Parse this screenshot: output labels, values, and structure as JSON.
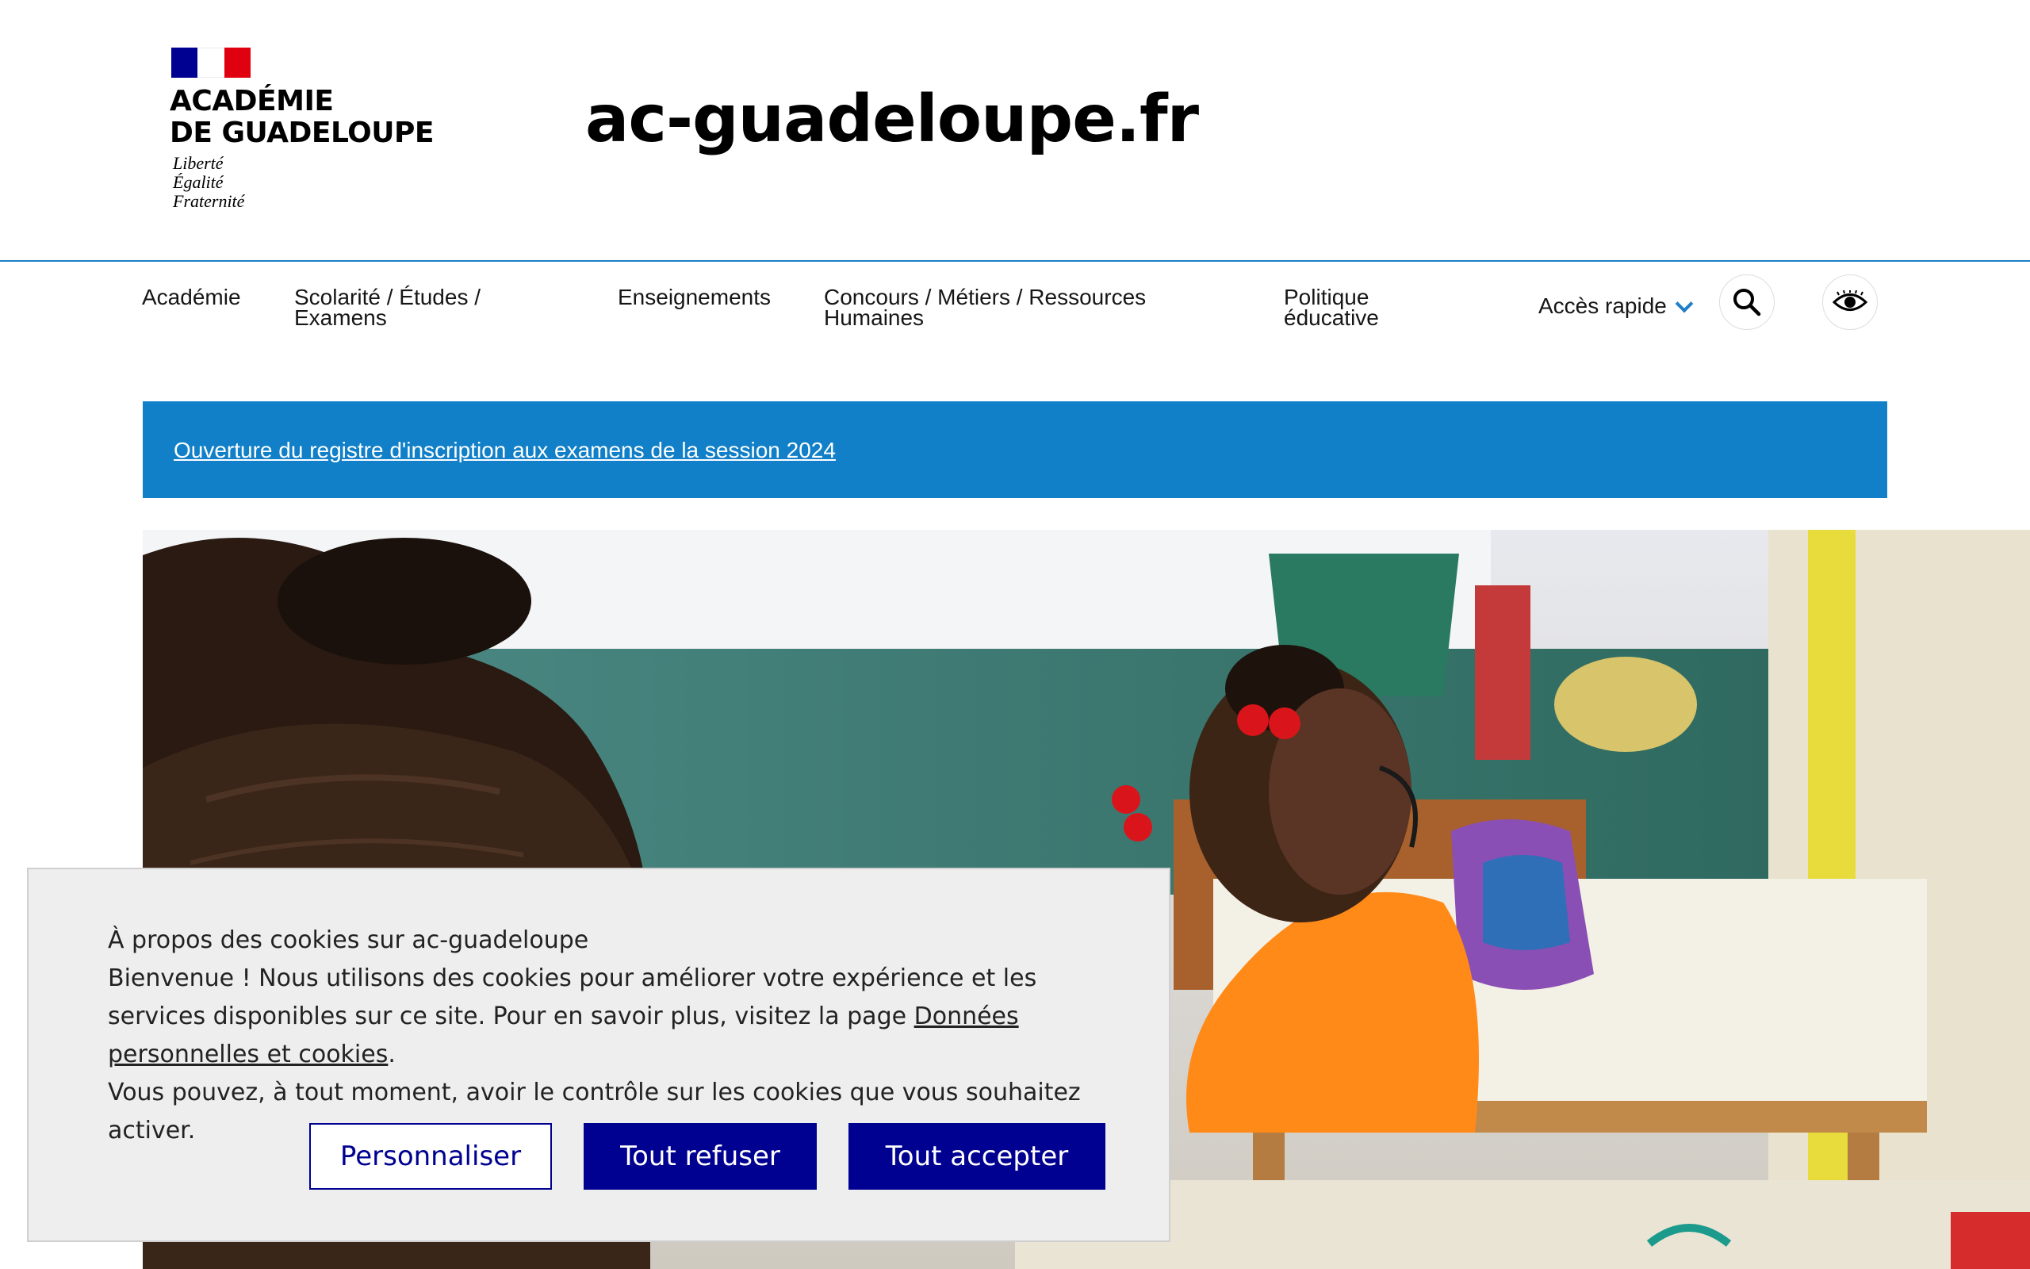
{
  "header": {
    "logo_name_line1": "ACADÉMIE",
    "logo_name_line2": "DE GUADELOUPE",
    "motto_line1": "Liberté",
    "motto_line2": "Égalité",
    "motto_line3": "Fraternité",
    "site_title": "ac-guadeloupe.fr"
  },
  "nav": {
    "items": [
      {
        "label_line1": "Académie",
        "label_line2": ""
      },
      {
        "label_line1": "Scolarité / Études /",
        "label_line2": "Examens"
      },
      {
        "label_line1": "Enseignements",
        "label_line2": ""
      },
      {
        "label_line1": "Concours / Métiers / Ressources",
        "label_line2": "Humaines"
      },
      {
        "label_line1": "Politique",
        "label_line2": "éducative"
      }
    ],
    "quick_access": "Accès rapide",
    "search_icon": "search-icon",
    "accessibility_icon": "eye-icon"
  },
  "banner": {
    "link_text": "Ouverture du registre d'inscription aux examens de la session 2024"
  },
  "cookie": {
    "title": "À propos des cookies sur ac-guadeloupe",
    "body_before_link": "Bienvenue ! Nous utilisons des cookies pour améliorer votre expérience et les services disponibles sur ce site. Pour en savoir plus, visitez la page ",
    "link": "Données personnelles et cookies",
    "body_after_link": ".",
    "body_line_last": "Vous pouvez, à tout moment, avoir le contrôle sur les cookies que vous souhaitez activer.",
    "buttons": {
      "customize": "Personnaliser",
      "refuse": "Tout refuser",
      "accept": "Tout accepter"
    }
  },
  "colors": {
    "primary": "#000091",
    "banner": "#1180c8",
    "accent_line": "#1e7ec8",
    "modal_bg": "#eeeeee"
  }
}
